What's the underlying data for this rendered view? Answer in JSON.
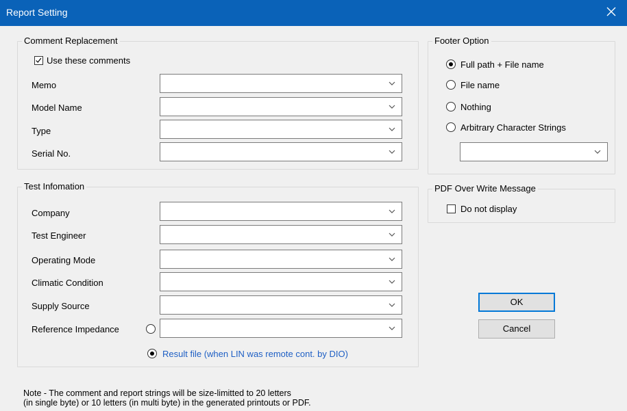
{
  "window": {
    "title": "Report Setting"
  },
  "comment_replacement": {
    "legend": "Comment Replacement",
    "use_comments_label": "Use these comments",
    "use_comments_checked": true,
    "fields": [
      {
        "label": "Memo",
        "value": ""
      },
      {
        "label": "Model Name",
        "value": ""
      },
      {
        "label": "Type",
        "value": ""
      },
      {
        "label": "Serial No.",
        "value": ""
      }
    ]
  },
  "test_information": {
    "legend": "Test Infomation",
    "fields": [
      {
        "label": "Company",
        "value": ""
      },
      {
        "label": "Test Engineer",
        "value": ""
      },
      {
        "label": "Operating Mode",
        "value": ""
      },
      {
        "label": "Climatic Condition",
        "value": ""
      },
      {
        "label": "Supply Source",
        "value": ""
      },
      {
        "label": "Reference Impedance",
        "value": ""
      }
    ],
    "result_file_label": "Result file (when LIN was remote cont. by DIO)",
    "result_file_selected": true
  },
  "footer_option": {
    "legend": "Footer Option",
    "options": [
      {
        "label": "Full path + File name",
        "selected": true
      },
      {
        "label": "File name",
        "selected": false
      },
      {
        "label": "Nothing",
        "selected": false
      },
      {
        "label": "Arbitrary Character Strings",
        "selected": false
      }
    ],
    "arbitrary_value": ""
  },
  "pdf_overwrite": {
    "legend": "PDF Over Write Message",
    "do_not_display_label": "Do not display",
    "do_not_display_checked": false
  },
  "buttons": {
    "ok": "OK",
    "cancel": "Cancel"
  },
  "note": {
    "line1": "Note - The comment and report strings will be size-limitted to 20 letters",
    "line2": "(in single byte) or 10 letters (in multi byte) in the generated printouts or PDF."
  },
  "colors": {
    "titlebar": "#0a62b8",
    "accent": "#0078d7",
    "link_text": "#1e5fc4"
  }
}
